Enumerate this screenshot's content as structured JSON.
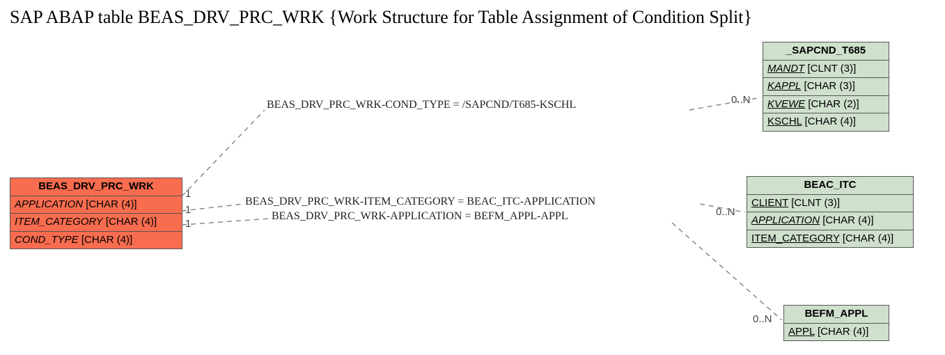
{
  "title": "SAP ABAP table BEAS_DRV_PRC_WRK {Work Structure for Table Assignment of Condition Split}",
  "entities": {
    "main": {
      "name": "BEAS_DRV_PRC_WRK",
      "fields": [
        {
          "label": "APPLICATION",
          "type": "[CHAR (4)]",
          "fk": true
        },
        {
          "label": "ITEM_CATEGORY",
          "type": "[CHAR (4)]",
          "fk": true
        },
        {
          "label": "COND_TYPE",
          "type": "[CHAR (4)]",
          "fk": true
        }
      ]
    },
    "t685": {
      "name": "_SAPCND_T685",
      "fields": [
        {
          "label": "MANDT",
          "type": "[CLNT (3)]",
          "pk": true,
          "fk": true
        },
        {
          "label": "KAPPL",
          "type": "[CHAR (3)]",
          "pk": true,
          "fk": true
        },
        {
          "label": "KVEWE",
          "type": "[CHAR (2)]",
          "pk": true,
          "fk": true
        },
        {
          "label": "KSCHL",
          "type": "[CHAR (4)]",
          "pk": true
        }
      ]
    },
    "itc": {
      "name": "BEAC_ITC",
      "fields": [
        {
          "label": "CLIENT",
          "type": "[CLNT (3)]",
          "pk": true
        },
        {
          "label": "APPLICATION",
          "type": "[CHAR (4)]",
          "pk": true,
          "fk": true
        },
        {
          "label": "ITEM_CATEGORY",
          "type": "[CHAR (4)]",
          "pk": true
        }
      ]
    },
    "appl": {
      "name": "BEFM_APPL",
      "fields": [
        {
          "label": "APPL",
          "type": "[CHAR (4)]",
          "pk": true
        }
      ]
    }
  },
  "relations": {
    "r1": {
      "label": "BEAS_DRV_PRC_WRK-COND_TYPE = /SAPCND/T685-KSCHL",
      "left_card": "1",
      "right_card": "0..N"
    },
    "r2": {
      "label": "BEAS_DRV_PRC_WRK-ITEM_CATEGORY = BEAC_ITC-APPLICATION",
      "left_card": "1",
      "right_card": "0..N"
    },
    "r3": {
      "label": "BEAS_DRV_PRC_WRK-APPLICATION = BEFM_APPL-APPL",
      "left_card": "1",
      "right_card": "0..N"
    }
  }
}
